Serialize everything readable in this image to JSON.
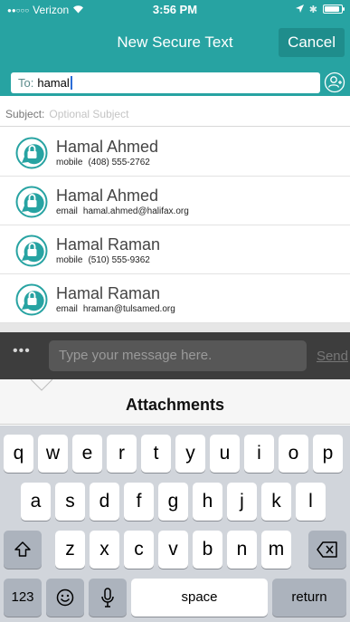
{
  "status_bar": {
    "carrier": "Verizon",
    "time": "3:56 PM"
  },
  "header": {
    "title": "New Secure Text",
    "cancel_label": "Cancel"
  },
  "to_field": {
    "label": "To:",
    "value": "hamal"
  },
  "subject": {
    "label": "Subject:",
    "placeholder": "Optional Subject"
  },
  "contacts": [
    {
      "name": "Hamal Ahmed",
      "kind": "mobile",
      "value": "(408) 555-2762"
    },
    {
      "name": "Hamal Ahmed",
      "kind": "email",
      "value": "hamal.ahmed@halifax.org"
    },
    {
      "name": "Hamal Raman",
      "kind": "mobile",
      "value": "(510) 555-9362"
    },
    {
      "name": "Hamal Raman",
      "kind": "email",
      "value": "hraman@tulsamed.org"
    }
  ],
  "compose": {
    "more": "•••",
    "placeholder": "Type your message here.",
    "send_label": "Send"
  },
  "attachments": {
    "label": "Attachments"
  },
  "keyboard": {
    "row1": [
      "q",
      "w",
      "e",
      "r",
      "t",
      "y",
      "u",
      "i",
      "o",
      "p"
    ],
    "row2": [
      "a",
      "s",
      "d",
      "f",
      "g",
      "h",
      "j",
      "k",
      "l"
    ],
    "row3": [
      "z",
      "x",
      "c",
      "v",
      "b",
      "n",
      "m"
    ],
    "numbers_label": "123",
    "space_label": "space",
    "return_label": "return"
  },
  "colors": {
    "accent": "#27a3a2",
    "accent_dark": "#1f8d8c",
    "compose_bg": "#3d3d3d"
  }
}
